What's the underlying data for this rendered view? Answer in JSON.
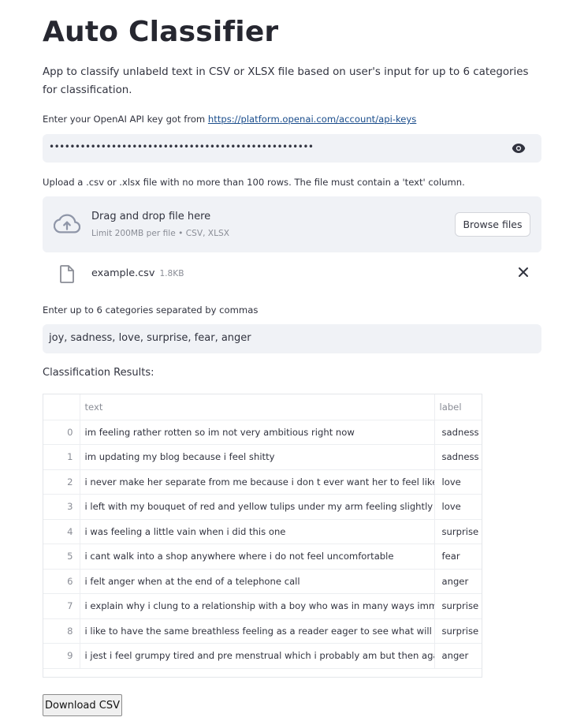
{
  "title": "Auto Classifier",
  "description": "App to classify unlabeld text in CSV or XLSX file based on user's input for up to 6 categories for classification.",
  "api_key": {
    "label_prefix": "Enter your OpenAI API key got from ",
    "link_text": "https://platform.openai.com/account/api-keys",
    "masked_value": "•••••••••••••••••••••••••••••••••••••••••••••••••••",
    "icon": "eye-icon"
  },
  "upload": {
    "label": "Upload a .csv or .xlsx file with no more than 100 rows. The file must contain a 'text' column.",
    "drop_title": "Drag and drop file here",
    "drop_subtitle": "Limit 200MB per file • CSV, XLSX",
    "browse_label": "Browse files",
    "file_name": "example.csv",
    "file_size": "1.8KB"
  },
  "categories": {
    "label": "Enter up to 6 categories separated by commas",
    "value": "joy, sadness, love, surprise, fear, anger"
  },
  "results": {
    "label": "Classification Results:",
    "columns": [
      "",
      "text",
      "label"
    ],
    "rows": [
      {
        "index": "0",
        "text": "im feeling rather rotten so im not very ambitious right now",
        "label": "sadness"
      },
      {
        "index": "1",
        "text": "im updating my blog because i feel shitty",
        "label": "sadness"
      },
      {
        "index": "2",
        "text": "i never make her separate from me because i don t ever want her to feel like i m ashar",
        "label": "love"
      },
      {
        "index": "3",
        "text": "i left with my bouquet of red and yellow tulips under my arm feeling slightly more opt",
        "label": "love"
      },
      {
        "index": "4",
        "text": "i was feeling a little vain when i did this one",
        "label": "surprise"
      },
      {
        "index": "5",
        "text": "i cant walk into a shop anywhere where i do not feel uncomfortable",
        "label": "fear"
      },
      {
        "index": "6",
        "text": "i felt anger when at the end of a telephone call",
        "label": "anger"
      },
      {
        "index": "7",
        "text": "i explain why i clung to a relationship with a boy who was in many ways immature an",
        "label": "surprise"
      },
      {
        "index": "8",
        "text": "i like to have the same breathless feeling as a reader eager to see what will happen ne",
        "label": "surprise"
      },
      {
        "index": "9",
        "text": "i jest i feel grumpy tired and pre menstrual which i probably am but then again its onl",
        "label": "anger"
      }
    ]
  },
  "download_label": "Download CSV"
}
